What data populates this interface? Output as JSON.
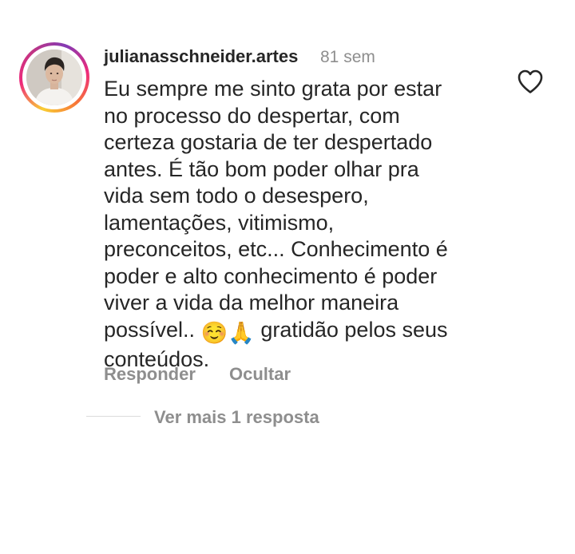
{
  "comment": {
    "username": "julianasschneider.artes",
    "timestamp": "81 sem",
    "text_lines": [
      "Eu sempre me sinto grata por estar",
      "no processo do despertar, com",
      "certeza gostaria de ter despertado",
      "antes. É tão bom poder olhar pra",
      "vida sem todo o desespero,",
      "lamentações, vitimismo,",
      "preconceitos, etc... Conhecimento é",
      "poder e alto conhecimento é poder",
      "viver a vida da melhor maneira"
    ],
    "last_line_prefix": "possível..",
    "emoji_1": "☺️",
    "emoji_2": "🙏",
    "last_line_suffix": "gratidão pelos seus",
    "final_line": "conteúdos.",
    "like_icon": "heart-outline-icon"
  },
  "actions": {
    "reply_label": "Responder",
    "hide_label": "Ocultar"
  },
  "replies": {
    "view_more_label": "Ver mais 1 resposta"
  },
  "colors": {
    "text": "#262626",
    "secondary_text": "#8e8e8e",
    "divider": "#dbdbdb",
    "story_ring_start": "#f9ce34",
    "story_ring_mid": "#ee2a7b",
    "story_ring_end": "#833ab4"
  }
}
